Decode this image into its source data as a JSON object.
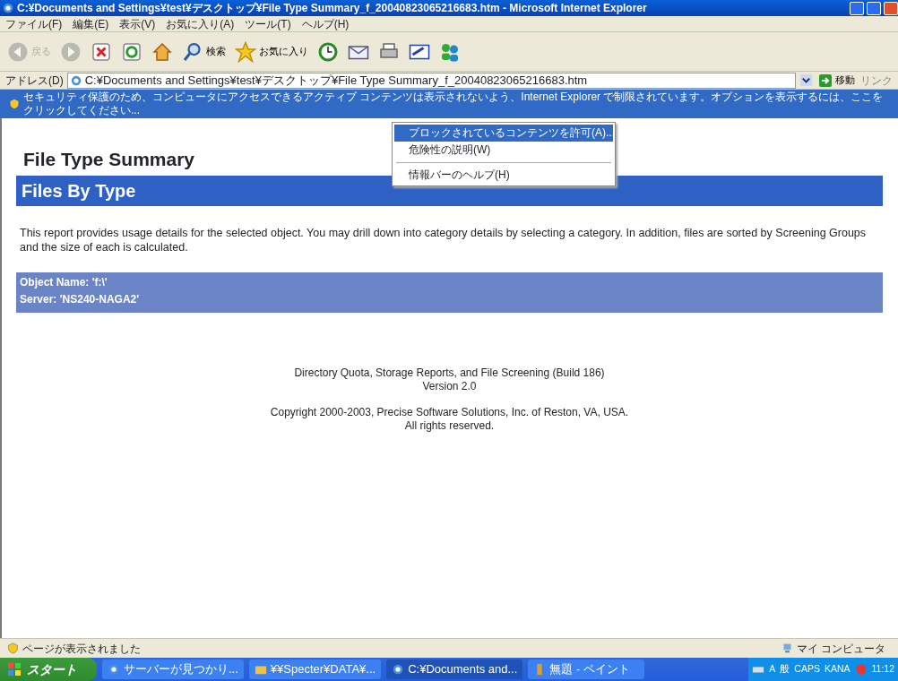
{
  "window": {
    "title": "C:¥Documents and Settings¥test¥デスクトップ¥File Type Summary_f_20040823065216683.htm - Microsoft Internet Explorer"
  },
  "menu_bar": [
    "ファイル(F)",
    "編集(E)",
    "表示(V)",
    "お気に入り(A)",
    "ツール(T)",
    "ヘルプ(H)"
  ],
  "toolbar": [
    {
      "kind": "back",
      "label": "戻る",
      "disabled": true
    },
    {
      "kind": "forward",
      "disabled": true
    },
    {
      "kind": "stop"
    },
    {
      "kind": "refresh"
    },
    {
      "kind": "home"
    },
    {
      "kind": "search",
      "label": "検索"
    },
    {
      "kind": "favorites",
      "label": "お気に入り"
    },
    {
      "kind": "history"
    },
    {
      "kind": "mail"
    },
    {
      "kind": "print"
    },
    {
      "kind": "edit"
    },
    {
      "kind": "messenger"
    }
  ],
  "address_bar": {
    "label": "アドレス(D)",
    "value": "C:¥Documents and Settings¥test¥デスクトップ¥File Type Summary_f_20040823065216683.htm",
    "go": "移動",
    "links": "リンク"
  },
  "info_bar": {
    "text": "セキュリティ保護のため、コンピュータにアクセスできるアクティブ コンテンツは表示されないよう、Internet Explorer で制限されています。オプションを表示するには、ここをクリックしてください..."
  },
  "context_menu": [
    {
      "label": "ブロックされているコンテンツを許可(A)...",
      "selected": true
    },
    {
      "label": "危険性の説明(W)",
      "selected": false
    },
    {
      "label": "情報バーのヘルプ(H)",
      "selected": false
    }
  ],
  "page": {
    "title": "File Type Summary",
    "heading": "Files By Type",
    "description": "This report provides usage details for the selected object. You may drill down into category details by selecting a category. In addition, files are sorted by Screening Groups and the size of each is calculated.",
    "object_name": "Object Name: 'f:\\'",
    "server": "Server: 'NS240-NAGA2'",
    "footer": [
      "Directory Quota, Storage Reports, and File Screening (Build 186)",
      "Version 2.0",
      "Copyright 2000-2003, Precise Software Solutions, Inc. of Reston, VA, USA.",
      "All rights reserved."
    ]
  },
  "status_bar": {
    "text": "ページが表示されました",
    "zone": "マイ コンピュータ"
  },
  "taskbar": {
    "start": "スタート",
    "tasks": [
      {
        "label": "サーバーが見つかり...",
        "selected": false
      },
      {
        "label": "¥¥Specter¥DATA¥...",
        "selected": false
      },
      {
        "label": "C:¥Documents and...",
        "selected": true
      },
      {
        "label": "無題 - ペイント",
        "selected": false
      }
    ],
    "tray": [
      "A",
      "般",
      "CAPS",
      "KANA"
    ],
    "clock": "11:12"
  }
}
